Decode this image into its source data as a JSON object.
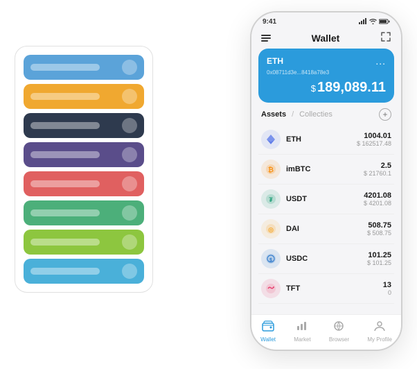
{
  "header": {
    "time": "9:41",
    "title": "Wallet"
  },
  "eth_card": {
    "name": "ETH",
    "address": "0x08711d3e...8418a78e3",
    "balance": "189,089.11",
    "dollar_sign": "$",
    "dots": "..."
  },
  "assets_section": {
    "tab_active": "Assets",
    "tab_divider": "/",
    "tab_inactive": "Collecties",
    "add_label": "+"
  },
  "assets": [
    {
      "symbol": "ETH",
      "icon": "◈",
      "icon_class": "icon-eth",
      "amount": "1004.01",
      "usd": "$ 162517.48"
    },
    {
      "symbol": "imBTC",
      "icon": "⊕",
      "icon_class": "icon-imbtc",
      "amount": "2.5",
      "usd": "$ 21760.1"
    },
    {
      "symbol": "USDT",
      "icon": "₮",
      "icon_class": "icon-usdt",
      "amount": "4201.08",
      "usd": "$ 4201.08"
    },
    {
      "symbol": "DAI",
      "icon": "◎",
      "icon_class": "icon-dai",
      "amount": "508.75",
      "usd": "$ 508.75"
    },
    {
      "symbol": "USDC",
      "icon": "©",
      "icon_class": "icon-usdc",
      "amount": "101.25",
      "usd": "$ 101.25"
    },
    {
      "symbol": "TFT",
      "icon": "🐦",
      "icon_class": "icon-tft",
      "amount": "13",
      "usd": "0"
    }
  ],
  "bottom_nav": [
    {
      "label": "Wallet",
      "icon": "⊙",
      "active": true
    },
    {
      "label": "Market",
      "icon": "📊",
      "active": false
    },
    {
      "label": "Browser",
      "icon": "👤",
      "active": false
    },
    {
      "label": "My Profile",
      "icon": "👤",
      "active": false
    }
  ],
  "card_stack": [
    {
      "color": "card-blue"
    },
    {
      "color": "card-orange"
    },
    {
      "color": "card-dark"
    },
    {
      "color": "card-purple"
    },
    {
      "color": "card-red"
    },
    {
      "color": "card-green"
    },
    {
      "color": "card-lightgreen"
    },
    {
      "color": "card-sky"
    }
  ]
}
